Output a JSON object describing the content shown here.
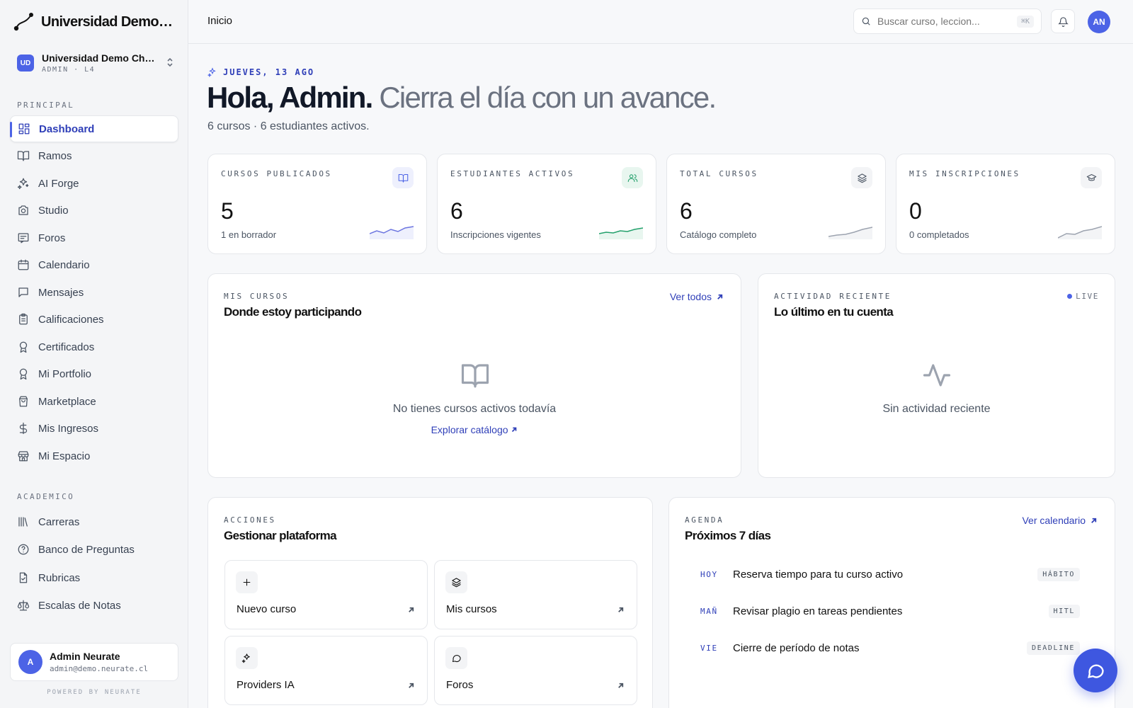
{
  "brand": {
    "name": "Universidad Demo Chile"
  },
  "tenant": {
    "badge": "UD",
    "name": "Universidad Demo Chile",
    "role": "ADMIN · L4"
  },
  "nav": {
    "principal_label": "PRINCIPAL",
    "academico_label": "ACADEMICO",
    "principal": [
      {
        "label": "Dashboard",
        "icon": "dashboard-icon"
      },
      {
        "label": "Ramos",
        "icon": "book-icon"
      },
      {
        "label": "AI Forge",
        "icon": "sparkles-icon"
      },
      {
        "label": "Studio",
        "icon": "camera-icon"
      },
      {
        "label": "Foros",
        "icon": "forum-icon"
      },
      {
        "label": "Calendario",
        "icon": "calendar-icon"
      },
      {
        "label": "Mensajes",
        "icon": "message-icon"
      },
      {
        "label": "Calificaciones",
        "icon": "clipboard-icon"
      },
      {
        "label": "Certificados",
        "icon": "award-icon"
      },
      {
        "label": "Mi Portfolio",
        "icon": "award-icon"
      },
      {
        "label": "Marketplace",
        "icon": "shopping-bag-icon"
      },
      {
        "label": "Mis Ingresos",
        "icon": "dollar-icon"
      },
      {
        "label": "Mi Espacio",
        "icon": "store-icon"
      }
    ],
    "academico": [
      {
        "label": "Carreras",
        "icon": "library-icon"
      },
      {
        "label": "Banco de Preguntas",
        "icon": "help-circle-icon"
      },
      {
        "label": "Rubricas",
        "icon": "file-check-icon"
      },
      {
        "label": "Escalas de Notas",
        "icon": "scale-icon"
      }
    ]
  },
  "user": {
    "initial": "A",
    "name": "Admin Neurate",
    "email": "admin@demo.neurate.cl"
  },
  "powered": "POWERED BY NEURATE",
  "topbar": {
    "breadcrumb": "Inicio",
    "search_placeholder": "Buscar curso, leccion...",
    "search_kbd": "⌘K",
    "avatar": "AN"
  },
  "hero": {
    "date": "JUEVES, 13 AGO",
    "greeting": "Hola, Admin.",
    "tagline": " Cierra el día con un avance.",
    "summary": "6 cursos · 6 estudiantes activos."
  },
  "stats": [
    {
      "label": "CURSOS PUBLICADOS",
      "value": "5",
      "note": "1 en borrador",
      "icon": "book-icon",
      "color": "#6b74e0"
    },
    {
      "label": "ESTUDIANTES ACTIVOS",
      "value": "6",
      "note": "Inscripciones vigentes",
      "icon": "users-icon",
      "color": "#22a06b"
    },
    {
      "label": "TOTAL CURSOS",
      "value": "6",
      "note": "Catálogo completo",
      "icon": "layers-icon",
      "color": "#6b7280"
    },
    {
      "label": "MIS INSCRIPCIONES",
      "value": "0",
      "note": "0 completados",
      "icon": "graduation-cap-icon",
      "color": "#6b7280"
    }
  ],
  "mis_cursos": {
    "label": "MIS CURSOS",
    "title": "Donde estoy participando",
    "link": "Ver todos",
    "empty": "No tienes cursos activos todavía",
    "empty_link": "Explorar catálogo"
  },
  "actividad": {
    "label": "ACTIVIDAD RECIENTE",
    "title": "Lo último en tu cuenta",
    "live": "LIVE",
    "empty": "Sin actividad reciente"
  },
  "acciones": {
    "label": "ACCIONES",
    "title": "Gestionar plataforma",
    "items": [
      {
        "label": "Nuevo curso",
        "icon": "plus-icon"
      },
      {
        "label": "Mis cursos",
        "icon": "layers-icon"
      },
      {
        "label": "Providers IA",
        "icon": "sparkles-icon"
      },
      {
        "label": "Foros",
        "icon": "chat-bubble-icon"
      }
    ]
  },
  "agenda": {
    "label": "AGENDA",
    "title": "Próximos 7 días",
    "link": "Ver calendario",
    "items": [
      {
        "day": "HOY",
        "text": "Reserva tiempo para tu curso activo",
        "tag": "HÁBITO"
      },
      {
        "day": "MAÑ",
        "text": "Revisar plagio en tareas pendientes",
        "tag": "HITL"
      },
      {
        "day": "VIE",
        "text": "Cierre de período de notas",
        "tag": "DEADLINE"
      }
    ]
  },
  "colors": {
    "accent": "#4c63e6",
    "accent_dark": "#2f3fb8",
    "green": "#22a06b"
  }
}
